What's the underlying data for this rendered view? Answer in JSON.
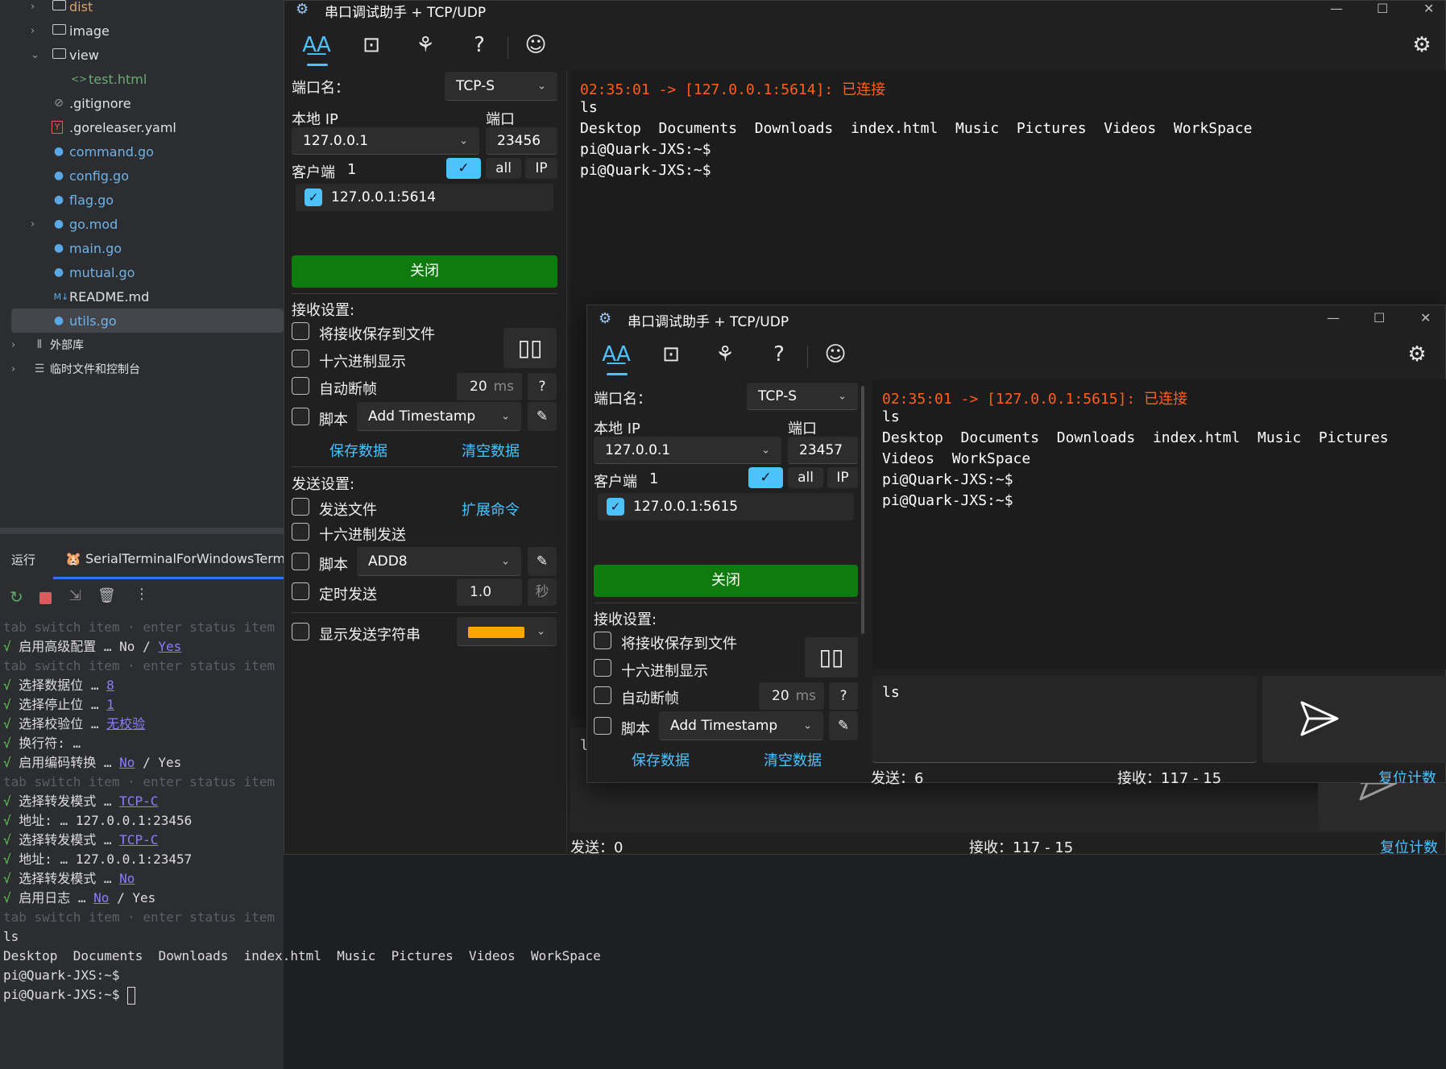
{
  "ide": {
    "tree": [
      {
        "label": "dist",
        "kind": "folder",
        "expanded": false,
        "level": 1
      },
      {
        "label": "image",
        "kind": "folder",
        "expanded": false,
        "level": 1
      },
      {
        "label": "view",
        "kind": "folder",
        "expanded": true,
        "level": 1
      },
      {
        "label": "test.html",
        "kind": "html",
        "level": 2
      },
      {
        "label": ".gitignore",
        "kind": "ignore",
        "level": 1
      },
      {
        "label": ".goreleaser.yaml",
        "kind": "yaml",
        "level": 1
      },
      {
        "label": "command.go",
        "kind": "go",
        "level": 1
      },
      {
        "label": "config.go",
        "kind": "go",
        "level": 1
      },
      {
        "label": "flag.go",
        "kind": "go",
        "level": 1
      },
      {
        "label": "go.mod",
        "kind": "gomod",
        "level": 1
      },
      {
        "label": "main.go",
        "kind": "go",
        "level": 1
      },
      {
        "label": "mutual.go",
        "kind": "go",
        "level": 1
      },
      {
        "label": "README.md",
        "kind": "md",
        "level": 1
      },
      {
        "label": "utils.go",
        "kind": "go",
        "level": 1
      },
      {
        "label": "外部库",
        "kind": "lib",
        "level": 0
      },
      {
        "label": "临时文件和控制台",
        "kind": "scratch",
        "level": 0
      }
    ],
    "run_tab_label": "运行",
    "run_config_label": "SerialTerminalForWindowsTermina",
    "md_badge": "M↓"
  },
  "console": {
    "hint_tab": "tab",
    "hint_switch": "switch item",
    "hint_enter": "enter",
    "hint_status": "status item",
    "lines": [
      {
        "type": "hint"
      },
      {
        "type": "opt",
        "label": "启用高级配置",
        "a": "No",
        "sep": "/",
        "b": "Yes",
        "sel": "b"
      },
      {
        "type": "hint"
      },
      {
        "type": "opt",
        "label": "选择数据位",
        "a": "8",
        "sel": "a"
      },
      {
        "type": "opt",
        "label": "选择停止位",
        "a": "1",
        "sel": "a"
      },
      {
        "type": "opt",
        "label": "选择校验位",
        "a": "无校验",
        "sel": "a"
      },
      {
        "type": "opt",
        "label": "换行符:",
        "noellipsis": true
      },
      {
        "type": "opt",
        "label": "启用编码转换",
        "a": "No",
        "sep": "/",
        "b": "Yes",
        "sel": "a"
      },
      {
        "type": "hint"
      },
      {
        "type": "opt",
        "label": "选择转发模式",
        "a": "TCP-C",
        "sel": "a"
      },
      {
        "type": "addr",
        "label": "地址:",
        "val": "127.0.0.1:23456"
      },
      {
        "type": "opt",
        "label": "选择转发模式",
        "a": "TCP-C",
        "sel": "a"
      },
      {
        "type": "addr",
        "label": "地址:",
        "val": "127.0.0.1:23457"
      },
      {
        "type": "opt",
        "label": "选择转发模式",
        "a": "No",
        "sel": "a"
      },
      {
        "type": "opt",
        "label": "启用日志",
        "a": "No",
        "sep": "/",
        "b": "Yes",
        "sel": "a"
      },
      {
        "type": "hint"
      },
      {
        "type": "plain",
        "text": "ls"
      },
      {
        "type": "plain",
        "text": "Desktop  Documents  Downloads  index.html  Music  Pictures  Videos  WorkSpace"
      },
      {
        "type": "plain",
        "text": "pi@Quark-JXS:~$"
      },
      {
        "type": "plain",
        "text": "pi@Quark-JXS:~$ "
      }
    ],
    "check": "√",
    "ellipsis": "…"
  },
  "win1": {
    "title": "串口调试助手 + TCP/UDP",
    "port_name_label": "端口名：",
    "port_name_value": "TCP-S",
    "local_ip_label": "本地 IP",
    "local_ip_value": "127.0.0.1",
    "port_label": "端口",
    "port_value": "23456",
    "client_label": "客户端",
    "client_count": "1",
    "all_label": "all",
    "ip_label": "IP",
    "client_item": "127.0.0.1:5614",
    "close_button": "关闭",
    "recv_settings": "接收设置:",
    "save_to_file": "将接收保存到文件",
    "hex_display": "十六进制显示",
    "auto_frame": "自动断帧",
    "auto_frame_value": "20",
    "auto_frame_unit": "ms",
    "help_q": "?",
    "script_label": "脚本",
    "recv_script_value": "Add Timestamp",
    "save_data": "保存数据",
    "clear_data": "清空数据",
    "send_settings": "发送设置:",
    "send_file": "发送文件",
    "ext_cmd": "扩展命令",
    "hex_send": "十六进制发送",
    "send_script_value": "ADD8",
    "timed_send": "定时发送",
    "timed_value": "1.0",
    "timed_unit": "秒",
    "show_send_str": "显示发送字符串",
    "send_str_color": "#ffa500",
    "terminal": [
      {
        "text": "02:35:01 -> [127.0.0.1:5614]: 已连接",
        "red": true
      },
      {
        "text": "ls"
      },
      {
        "text": "Desktop  Documents  Downloads  index.html  Music  Pictures  Videos  WorkSpace"
      },
      {
        "text": "pi@Quark-JXS:~$"
      },
      {
        "text": "pi@Quark-JXS:~$"
      }
    ],
    "input_text": "l",
    "sent_label": "发送：0",
    "recv_label": "接收：117 - 15",
    "reset_count": "复位计数"
  },
  "win2": {
    "title": "串口调试助手 + TCP/UDP",
    "port_name_label": "端口名：",
    "port_name_value": "TCP-S",
    "local_ip_label": "本地 IP",
    "local_ip_value": "127.0.0.1",
    "port_label": "端口",
    "port_value": "23457",
    "client_label": "客户端",
    "client_count": "1",
    "all_label": "all",
    "ip_label": "IP",
    "client_item": "127.0.0.1:5615",
    "close_button": "关闭",
    "recv_settings": "接收设置:",
    "save_to_file": "将接收保存到文件",
    "hex_display": "十六进制显示",
    "auto_frame": "自动断帧",
    "auto_frame_value": "20",
    "auto_frame_unit": "ms",
    "help_q": "?",
    "script_label": "脚本",
    "recv_script_value": "Add Timestamp",
    "save_data": "保存数据",
    "clear_data": "清空数据",
    "terminal": [
      {
        "text": "02:35:01 -> [127.0.0.1:5615]: 已连接",
        "red": true
      },
      {
        "text": "ls"
      },
      {
        "text": "Desktop  Documents  Downloads  index.html  Music  Pictures"
      },
      {
        "text": "Videos  WorkSpace"
      },
      {
        "text": "pi@Quark-JXS:~$"
      },
      {
        "text": "pi@Quark-JXS:~$"
      }
    ],
    "input_text": "ls",
    "sent_label": "发送：6",
    "recv_label": "接收：117 - 15",
    "reset_count": "复位计数"
  },
  "colors": {
    "accent": "#4cc2ff",
    "green": "#0f7b0f",
    "red_text": "#ff5f1f",
    "link": "#8d7cff",
    "ok": "#61c554"
  }
}
